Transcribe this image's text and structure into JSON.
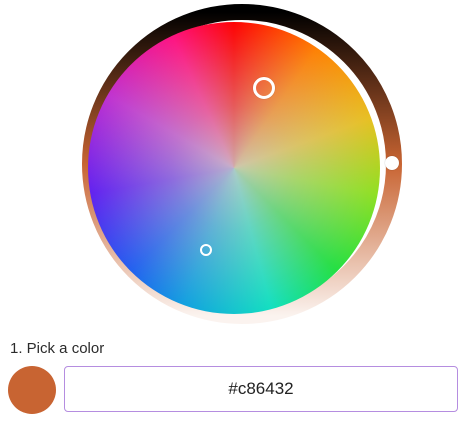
{
  "picker": {
    "selected_color": "#c86432",
    "lightness_ring_colors": [
      "#000000",
      "#c86432",
      "#ffffff"
    ]
  },
  "form": {
    "step_label": "1. Pick a color",
    "hex_value": "#c86432"
  }
}
